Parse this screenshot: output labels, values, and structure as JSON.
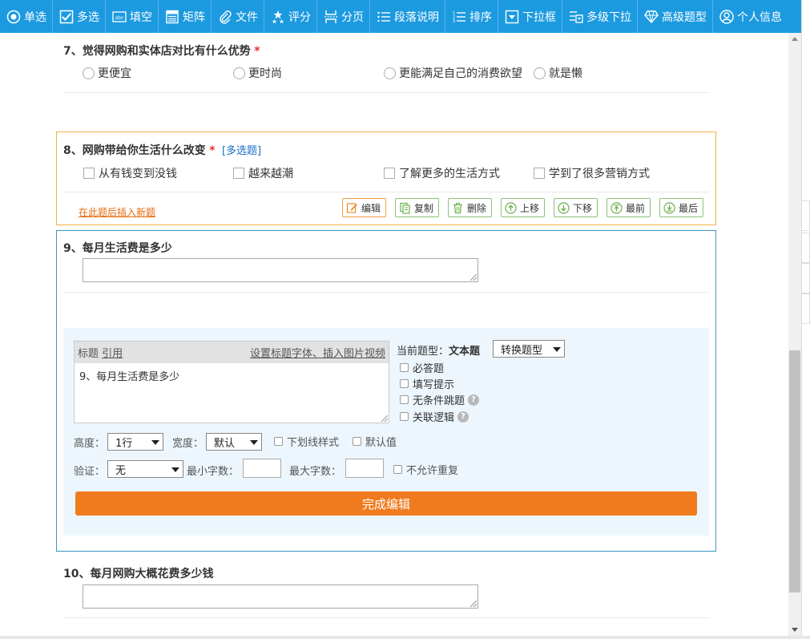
{
  "toolbar": {
    "items": [
      {
        "label": "单选",
        "icon": "radio-icon"
      },
      {
        "label": "多选",
        "icon": "checkbox-icon"
      },
      {
        "label": "填空",
        "icon": "text-field-icon"
      },
      {
        "label": "矩阵",
        "icon": "matrix-icon"
      },
      {
        "label": "文件",
        "icon": "paperclip-icon"
      },
      {
        "label": "评分",
        "icon": "stars-icon"
      },
      {
        "label": "分页",
        "icon": "page-break-icon"
      },
      {
        "label": "段落说明",
        "icon": "paragraph-icon"
      },
      {
        "label": "排序",
        "icon": "sort-icon"
      },
      {
        "label": "下拉框",
        "icon": "dropdown-icon"
      },
      {
        "label": "多级下拉",
        "icon": "cascade-dropdown-icon"
      },
      {
        "label": "高级题型",
        "icon": "diamond-icon"
      },
      {
        "label": "个人信息",
        "icon": "user-icon"
      }
    ],
    "bg_color": "#1c9ae0"
  },
  "q7": {
    "title": "7、觉得网购和实体店对比有什么优势",
    "required_mark": "*",
    "options": [
      "更便宜",
      "更时尚",
      "更能满足自己的消费欲望",
      "就是懒"
    ]
  },
  "q8": {
    "title": "8、网购带给你生活什么改变",
    "required_mark": "*",
    "tag": "[多选题]",
    "options": [
      "从有钱变到没钱",
      "越来越潮",
      "了解更多的生活方式",
      "学到了很多营销方式"
    ],
    "insert_link": "在此题后插入新题",
    "actions": [
      "编辑",
      "复制",
      "删除",
      "上移",
      "下移",
      "最前",
      "最后"
    ]
  },
  "q9": {
    "title": "9、每月生活费是多少",
    "editor": {
      "header_label": "标题",
      "quote_link": "引用",
      "font_link": "设置标题字体、插入图片视频",
      "title_value": "9、每月生活费是多少",
      "current_type_label": "当前题型：",
      "current_type": "文本题",
      "convert_select": "转换题型",
      "checks": [
        "必答题",
        "填写提示",
        "无条件跳题",
        "关联逻辑"
      ],
      "height_label": "高度：",
      "height_value": "1行",
      "width_label": "宽度：",
      "width_value": "默认",
      "underline_style": "下划线样式",
      "default_value": "默认值",
      "validate_label": "验证：",
      "validate_value": "无",
      "min_chars_label": "最小字数：",
      "max_chars_label": "最大字数：",
      "no_duplicate": "不允许重复",
      "done_button": "完成编辑"
    }
  },
  "q10": {
    "title": "10、每月网购大概花费多少钱"
  },
  "colors": {
    "accent_orange": "#f07b1e",
    "required_red": "#e3302e",
    "hover_border": "#f5b04a",
    "edit_border": "#3a96c4",
    "action_green": "#8cc37a"
  }
}
